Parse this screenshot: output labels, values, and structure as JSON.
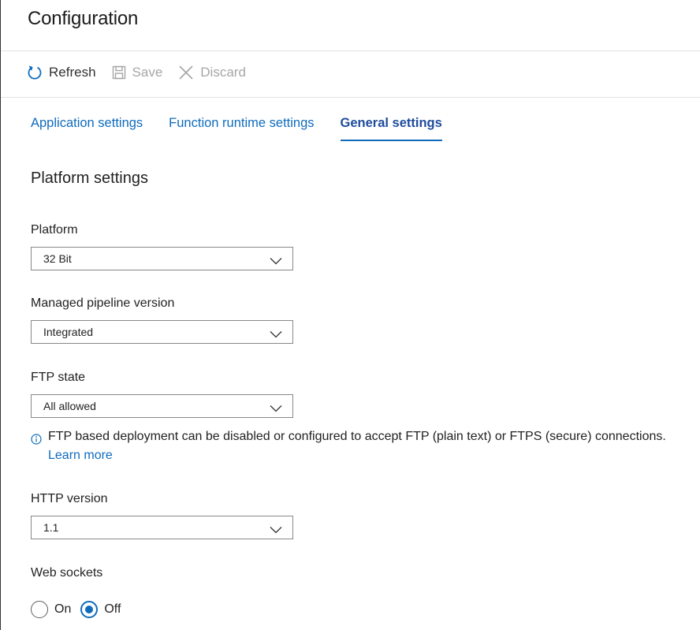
{
  "page": {
    "title": "Configuration"
  },
  "toolbar": {
    "refresh_label": "Refresh",
    "save_label": "Save",
    "discard_label": "Discard",
    "refresh_icon": "refresh-icon",
    "save_icon": "save-icon",
    "discard_icon": "close-icon"
  },
  "tabs": [
    {
      "label": "Application settings",
      "active": false
    },
    {
      "label": "Function runtime settings",
      "active": false
    },
    {
      "label": "General settings",
      "active": true
    }
  ],
  "section": {
    "title": "Platform settings"
  },
  "fields": {
    "platform": {
      "label": "Platform",
      "value": "32 Bit"
    },
    "pipeline": {
      "label": "Managed pipeline version",
      "value": "Integrated"
    },
    "ftp": {
      "label": "FTP state",
      "value": "All allowed"
    },
    "http": {
      "label": "HTTP version",
      "value": "1.1"
    }
  },
  "ftp_info": {
    "text": "FTP based deployment can be disabled or configured to accept FTP (plain text) or FTPS (secure) connections.",
    "link": "Learn more",
    "icon": "info-icon"
  },
  "web_sockets": {
    "label": "Web sockets",
    "options": [
      {
        "label": "On",
        "selected": false
      },
      {
        "label": "Off",
        "selected": true
      }
    ]
  },
  "colors": {
    "accent": "#0f6cbd",
    "active_tab_text": "#1f4c9d",
    "disabled_text": "#a6a6a6",
    "border": "#8a8886"
  }
}
